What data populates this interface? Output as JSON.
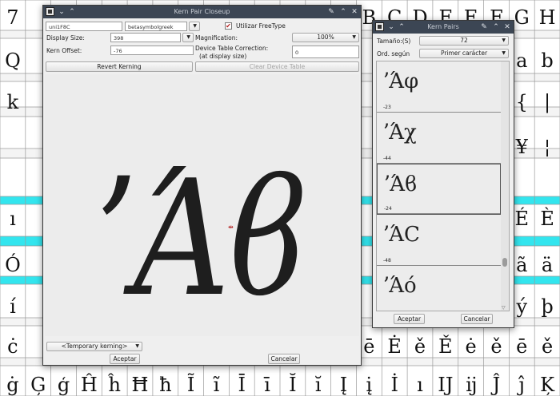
{
  "background_glyphs": [
    [
      "7",
      "",
      "",
      "",
      "",
      "",
      "",
      "",
      "",
      "",
      "",
      "",
      "",
      "",
      "B",
      "C",
      "D",
      "F",
      "E",
      "F",
      "G",
      "H"
    ],
    [
      "Q",
      "",
      "",
      "",
      "",
      "",
      "",
      "",
      "",
      "",
      "",
      "",
      "",
      "",
      "",
      "",
      "",
      "",
      "",
      "",
      "a",
      "b"
    ],
    [
      "k",
      "",
      "",
      "",
      "",
      "",
      "",
      "",
      "",
      "",
      "",
      "",
      "",
      "",
      "",
      "",
      "",
      "",
      "",
      "",
      "{",
      "|"
    ],
    [
      "",
      "",
      "",
      "",
      "",
      "",
      "",
      "",
      "",
      "",
      "",
      "",
      "",
      "",
      "",
      "",
      "",
      "",
      "",
      "",
      "¥",
      "¦"
    ],
    [
      "ı",
      "",
      "",
      "",
      "",
      "",
      "",
      "",
      "",
      "",
      "",
      "",
      "",
      "",
      "",
      "",
      "",
      "",
      "",
      "",
      "É",
      "È"
    ],
    [
      "Ó",
      "",
      "",
      "",
      "",
      "",
      "",
      "",
      "",
      "",
      "",
      "",
      "",
      "",
      "",
      "",
      "",
      "",
      "",
      "",
      "ã",
      "ä"
    ],
    [
      "í",
      "",
      "",
      "",
      "",
      "",
      "",
      "",
      "",
      "",
      "",
      "",
      "",
      "",
      "",
      "",
      "",
      "",
      "",
      "",
      "ý",
      "þ"
    ],
    [
      "ċ",
      "",
      "",
      "",
      "",
      "",
      "",
      "",
      "",
      "",
      "",
      "",
      "",
      "",
      "ē",
      "Ė",
      "ě",
      "Ě",
      "ė",
      "ě",
      "ē",
      "ě"
    ],
    [
      "ġ",
      "Ģ",
      "ģ",
      "Ĥ",
      "ĥ",
      "Ħ",
      "ħ",
      "Ĩ",
      "ĩ",
      "Ī",
      "ī",
      "Ĭ",
      "ĭ",
      "Į",
      "į",
      "İ",
      "ı",
      "Ĳ",
      "ĳ",
      "Ĵ",
      "ĵ",
      "Ķ"
    ]
  ],
  "closeup": {
    "title": "Kern Pair Closeup",
    "left_glyph_name": "uni1F8C",
    "right_glyph_name": "betasymbolgreek",
    "freetype_label": "Utilizar FreeType",
    "freetype_checked": true,
    "display_size_label": "Display Size:",
    "display_size_value": "398",
    "magnification_label": "Magnification:",
    "magnification_value": "100%",
    "kern_offset_label": "Kern Offset:",
    "kern_offset_value": "-76",
    "device_table_label_1": "Device Table Correction:",
    "device_table_label_2": "(at display size)",
    "device_table_value": "0",
    "revert_label": "Revert Kerning",
    "clear_device_label": "Clear Device Table",
    "preview_glyphs": "ʼΆϐ",
    "kerning_mode": "<Temporary kerning>",
    "ok_label": "Aceptar",
    "cancel_label": "Cancelar",
    "accent_color": "#b01818"
  },
  "kern_pairs": {
    "title": "Kern Pairs",
    "size_label": "Tamaño:(S)",
    "size_value": "72",
    "sort_label": "Ord. según",
    "sort_value": "Primer carácter",
    "items": [
      {
        "glyphs": "ʼΆφ",
        "value": "-23"
      },
      {
        "glyphs": "ʼΆχ",
        "value": "-44"
      },
      {
        "glyphs": "ʼΆϐ",
        "value": "-24"
      },
      {
        "glyphs": "ʼΆC",
        "value": "-48"
      },
      {
        "glyphs": "ʼΆό",
        "value": ""
      }
    ],
    "selected_index": 2,
    "ok_label": "Aceptar",
    "cancel_label": "Cancelar"
  },
  "colors": {
    "highlight_row": "#33e5ee",
    "titlebar": "#3c4654"
  }
}
